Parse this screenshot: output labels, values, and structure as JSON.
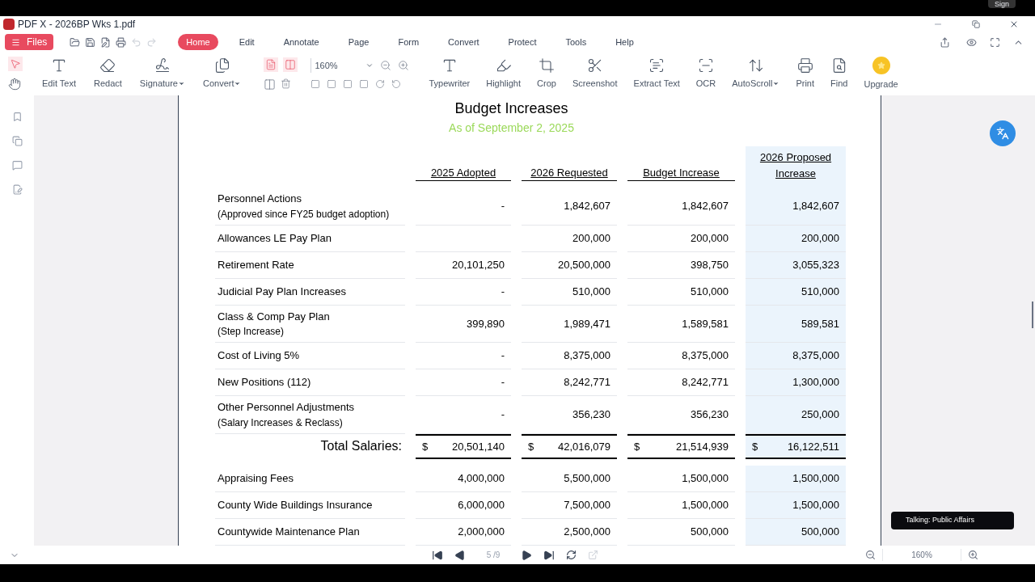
{
  "window": {
    "title": "PDF X - 2026BP Wks 1.pdf",
    "sign": "Sign"
  },
  "files_button": "Files",
  "menu": [
    {
      "label": "Home",
      "selected": true
    },
    {
      "label": "Edit",
      "selected": false
    },
    {
      "label": "Annotate",
      "selected": false
    },
    {
      "label": "Page",
      "selected": false
    },
    {
      "label": "Form",
      "selected": false
    },
    {
      "label": "Convert",
      "selected": false
    },
    {
      "label": "Protect",
      "selected": false
    },
    {
      "label": "Tools",
      "selected": false
    },
    {
      "label": "Help",
      "selected": false
    }
  ],
  "tools_left": [
    {
      "label": "Edit Text",
      "kind": "edittext",
      "dropdown": false
    },
    {
      "label": "Redact",
      "kind": "redact",
      "dropdown": false
    },
    {
      "label": "Signature",
      "kind": "signature",
      "dropdown": true
    },
    {
      "label": "Convert",
      "kind": "convert",
      "dropdown": true
    }
  ],
  "zoom_select": "160%",
  "tools_right": [
    {
      "label": "Typewriter",
      "kind": "type",
      "dropdown": false
    },
    {
      "label": "Highlight",
      "kind": "highlight",
      "dropdown": false
    },
    {
      "label": "Crop",
      "kind": "crop",
      "dropdown": false
    },
    {
      "label": "Screenshot",
      "kind": "scissors",
      "dropdown": false
    },
    {
      "label": "Extract Text",
      "kind": "extract",
      "dropdown": false
    },
    {
      "label": "OCR",
      "kind": "ocr",
      "dropdown": false
    },
    {
      "label": "AutoScroll",
      "kind": "autoscroll",
      "dropdown": true
    },
    {
      "label": "Print",
      "kind": "print",
      "dropdown": false
    },
    {
      "label": "Find",
      "kind": "find",
      "dropdown": false
    },
    {
      "label": "Upgrade",
      "kind": "upgrade",
      "dropdown": false
    }
  ],
  "document": {
    "title": "Budget Increases",
    "subtitle": "As of September 2, 2025",
    "columns": [
      "2025 Adopted",
      "2026 Requested",
      "Budget Increase",
      "2026 Proposed Increase"
    ],
    "rows": [
      {
        "label": "Personnel Actions",
        "note": "(Approved since FY25 budget adoption)",
        "values": [
          "-",
          "1,842,607",
          "1,842,607",
          "1,842,607"
        ]
      },
      {
        "label": "Allowances LE Pay Plan",
        "values": {
          "requested": "200,000",
          "increase": "200,000",
          "proposed": "200,000"
        }
      },
      {
        "label": "Retirement Rate",
        "values": [
          "20,101,250",
          "20,500,000",
          "398,750",
          "3,055,323"
        ]
      },
      {
        "label": "Judicial Pay Plan Increases",
        "values": [
          "-",
          "510,000",
          "510,000",
          "510,000"
        ]
      },
      {
        "label": "Class & Comp Pay Plan",
        "note": "(Step Increase)",
        "values": [
          "399,890",
          "1,989,471",
          "1,589,581",
          "589,581"
        ]
      },
      {
        "label": "Cost of Living 5%",
        "values": [
          "-",
          "8,375,000",
          "8,375,000",
          "8,375,000"
        ]
      },
      {
        "label": "New Positions (112)",
        "values": [
          "-",
          "8,242,771",
          "8,242,771",
          "1,300,000"
        ]
      },
      {
        "label": "Other Personnel Adjustments",
        "note": "(Salary Increases & Reclass)",
        "values": [
          "-",
          "356,230",
          "356,230",
          "250,000"
        ]
      }
    ],
    "total": {
      "label": "Total Salaries:",
      "currency": "$",
      "values": [
        "20,501,140",
        "42,016,079",
        "21,514,939",
        "16,122,511"
      ]
    },
    "rows2": [
      {
        "label": "Appraising Fees",
        "values": [
          "4,000,000",
          "5,500,000",
          "1,500,000",
          "1,500,000"
        ]
      },
      {
        "label": "County Wide Buildings Insurance",
        "values": [
          "6,000,000",
          "7,500,000",
          "1,500,000",
          "1,500,000"
        ]
      },
      {
        "label": "Countywide Maintenance Plan",
        "values": [
          "2,000,000",
          "2,500,000",
          "500,000",
          "500,000"
        ]
      }
    ]
  },
  "page_field": "5 /9",
  "zoom_level": "160%",
  "toast": "Talking: Public Affairs"
}
